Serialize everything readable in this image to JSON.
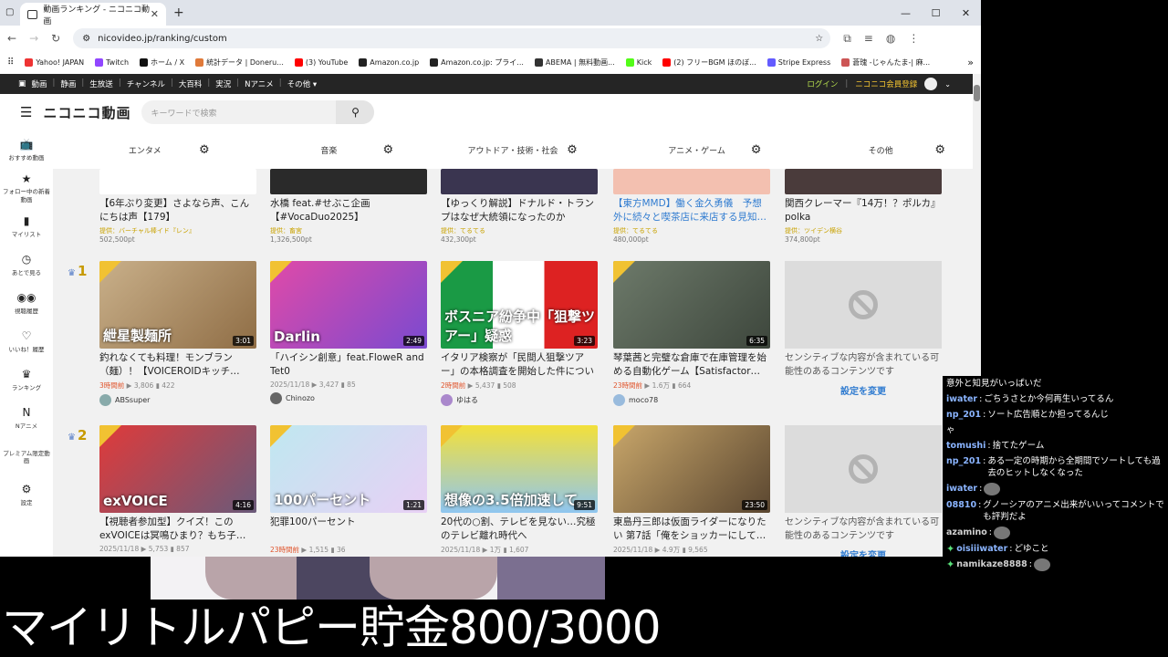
{
  "browser": {
    "tab_title": "動画ランキング - ニコニコ動画",
    "url": "nicovideo.jp/ranking/custom",
    "bookmarks": [
      {
        "label": "Yahoo! JAPAN",
        "color": "#e33"
      },
      {
        "label": "Twitch",
        "color": "#9146ff"
      },
      {
        "label": "ホーム / X",
        "color": "#111"
      },
      {
        "label": "統計データ | Doneru...",
        "color": "#e07a3a"
      },
      {
        "label": "(3) YouTube",
        "color": "#f00"
      },
      {
        "label": "Amazon.co.jp",
        "color": "#222"
      },
      {
        "label": "Amazon.co.jp: プライ...",
        "color": "#222"
      },
      {
        "label": "ABEMA | 無料動画...",
        "color": "#333"
      },
      {
        "label": "Kick",
        "color": "#53fc18"
      },
      {
        "label": "(2) フリーBGM ほのぼ...",
        "color": "#f00"
      },
      {
        "label": "Stripe Express",
        "color": "#635bff"
      },
      {
        "label": "蒼瑰 -じゃんたま-| 麻...",
        "color": "#c55"
      }
    ]
  },
  "nico": {
    "topnav": [
      "動画",
      "静画",
      "生放送",
      "チャンネル",
      "大百科",
      "実況",
      "Nアニメ",
      "その他 ▾"
    ],
    "login": "ログイン",
    "register": "ニコニコ会員登録",
    "logo": "ニコニコ動画",
    "search_placeholder": "キーワードで検索",
    "sidebar": [
      {
        "icon": "📺",
        "label": "おすすめ動画",
        "name": "recommended"
      },
      {
        "icon": "★",
        "label": "フォロー中の新着動画",
        "name": "following"
      },
      {
        "icon": "▮",
        "label": "マイリスト",
        "name": "mylist"
      },
      {
        "icon": "◷",
        "label": "あとで見る",
        "name": "watch-later"
      },
      {
        "icon": "◉◉",
        "label": "視聴履歴",
        "name": "history"
      },
      {
        "icon": "♡",
        "label": "いいね！履歴",
        "name": "likes"
      },
      {
        "icon": "♛",
        "label": "ランキング",
        "name": "ranking"
      },
      {
        "icon": "N",
        "label": "Nアニメ",
        "name": "nanime"
      },
      {
        "icon": "",
        "label": "プレミアム限定動画",
        "name": "premium"
      },
      {
        "icon": "⚙",
        "label": "設定",
        "name": "settings"
      }
    ],
    "genres": [
      "エンタメ",
      "音楽",
      "アウトドア・技術・社会",
      "アニメ・ゲーム",
      "その他"
    ],
    "top_row": [
      {
        "title": "【6年ぶり変更】さよなら声、こんにちは声【179】",
        "provider": "提供：バーチャル棒イド『レン』",
        "points": "502,500pt",
        "link": false
      },
      {
        "title": "水橋 feat.#せぶこ企画【#VocaDuo2025】",
        "provider": "提供：畜宮",
        "points": "1,326,500pt",
        "link": false
      },
      {
        "title": "【ゆっくり解説】ドナルド・トランプはなぜ大統領になったのか",
        "provider": "提供：てるてる",
        "points": "432,300pt",
        "link": false
      },
      {
        "title": "【東方MMD】働く金久勇儀　予想外に続々と喫茶店に来店する見知…",
        "provider": "提供：てるてる",
        "points": "480,000pt",
        "link": true
      },
      {
        "title": "関西クレーマー『14万！？ポルカ』polka",
        "provider": "提供：ツイデン横谷",
        "points": "374,800pt",
        "link": false
      }
    ],
    "rank1": {
      "rank": "1",
      "videos": [
        {
          "title": "釣れなくても料理！モンブラン（麺）！【VOICEROIDキッチ…",
          "caption": "紲星製麺所",
          "duration": "3:01",
          "time": "3時間前",
          "time_new": true,
          "views": "3,806",
          "comments": "422",
          "owner": "ABSsuper",
          "av": "#8aa"
        },
        {
          "title": "「ハイシン創意」feat.FloweR and Tet0",
          "caption": "Darlin",
          "duration": "2:49",
          "time": "2025/11/18",
          "time_new": false,
          "views": "3,427",
          "comments": "85",
          "owner": "Chinozo",
          "av": "#666"
        },
        {
          "title": "イタリア検察が「民間人狙撃ツアー」の本格調査を開始した件について",
          "caption": "ボスニア紛争中「狙撃ツアー」疑惑",
          "duration": "3:23",
          "time": "2時間前",
          "time_new": true,
          "views": "5,437",
          "comments": "508",
          "owner": "ゆはる",
          "av": "#a8c"
        },
        {
          "title": "琴葉茜と完璧な倉庫で在庫管理を始める自動化ゲーム【Satisfactor…",
          "caption": "",
          "duration": "6:35",
          "time": "23時間前",
          "time_new": true,
          "views": "1.6万",
          "comments": "664",
          "owner": "moco78",
          "av": "#9bd"
        },
        {
          "sensitive": true,
          "text": "センシティブな内容が含まれている可能性のあるコンテンツです",
          "link": "設定を変更"
        }
      ]
    },
    "rank2": {
      "rank": "2",
      "videos": [
        {
          "title": "【視聴者参加型】クイズ！このexVOICEは冥鳴ひまり？もち子…",
          "caption": "exVOICE",
          "duration": "4:16",
          "time": "2025/11/18",
          "time_new": false,
          "views": "5,753",
          "comments": "857",
          "owner": "",
          "av": ""
        },
        {
          "title": "犯罪100パーセント",
          "caption": "100パーセント",
          "duration": "1:21",
          "time": "23時間前",
          "time_new": true,
          "views": "1,515",
          "comments": "36",
          "owner": "",
          "av": ""
        },
        {
          "title": "20代の○割、テレビを見ない…究極のテレビ離れ時代へ",
          "caption": "想像の3.5倍加速して",
          "duration": "9:51",
          "time": "2025/11/18",
          "time_new": false,
          "views": "1万",
          "comments": "1,607",
          "owner": "",
          "av": ""
        },
        {
          "title": "東島丹三郎は仮面ライダーになりたい 第7話「俺をショッカーにして…",
          "caption": "",
          "duration": "23:50",
          "time": "2025/11/18",
          "time_new": false,
          "views": "4.9万",
          "comments": "9,565",
          "owner": "",
          "av": ""
        },
        {
          "sensitive": true,
          "text": "センシティブな内容が含まれている可能性のあるコンテンツです",
          "link": "設定を変更"
        }
      ]
    }
  },
  "overlay_text": "マイリトルパピー貯金800/3000",
  "chat": [
    {
      "user": "",
      "text": "意外と知見がいっぱいだ",
      "color": ""
    },
    {
      "user": "iwater",
      "text": "ごちうさとか今何再生いってるん",
      "color": "#8ab4ff"
    },
    {
      "user": "np_201",
      "text": "ソート広告順とか担ってるんじ",
      "color": "#8ab4ff"
    },
    {
      "user": "",
      "text": "ゃ",
      "color": ""
    },
    {
      "user": "tomushi",
      "text": "捨てたゲーム",
      "color": "#8ab4ff"
    },
    {
      "user": "np_201",
      "text": "ある一定の時期から全期間でソートしても過去のヒットしなくなった",
      "color": "#8ab4ff"
    },
    {
      "user": "iwater",
      "text": "",
      "color": "#8ab4ff",
      "emote": true
    },
    {
      "user": "08810",
      "text": "グノーシアのアニメ出来がいいってコメントでも評判だよ",
      "color": "#8ab4ff"
    },
    {
      "user": "azamino",
      "text": "",
      "color": "#d0d0d0",
      "emote": true
    },
    {
      "user": "oisiiiwater",
      "text": "どゆこと",
      "color": "#8ab4ff",
      "sparkle": true
    },
    {
      "user": "namikaze8888",
      "text": "",
      "color": "#d0d0d0",
      "emote": true,
      "sparkle": true
    }
  ]
}
